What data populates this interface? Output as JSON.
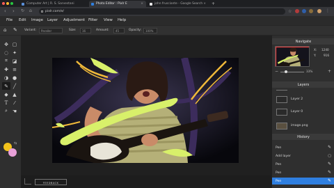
{
  "browser": {
    "tabs": [
      {
        "label": "Computer Art | R. S. Sarvestani"
      },
      {
        "label": "Photo Editor : Pixlr E",
        "active": true
      },
      {
        "label": "john frusciante - Google Search"
      }
    ],
    "url": "pixlr.com/e/",
    "window_dots": [
      "#ff5f57",
      "#febc2e",
      "#28c840"
    ]
  },
  "menubar": {
    "items": [
      "File",
      "Edit",
      "Image",
      "Layer",
      "Adjustment",
      "Filter",
      "View",
      "Help"
    ]
  },
  "options": {
    "variant_label": "Variant:",
    "variant_value": "Paraller",
    "size_label": "Size:",
    "size_value": "16",
    "amount_label": "Amount:",
    "amount_value": "45",
    "opacity_label": "Opacity:",
    "opacity_value": "100%"
  },
  "colors": {
    "primary": "#f2c21b",
    "secondary": "#e8a0d8",
    "accent": "#2f7fe0",
    "stroke": "#d8f06a"
  },
  "tools": [
    "move-icon",
    "marquee-icon",
    "lasso-icon",
    "wand-icon",
    "crop-icon",
    "slice-icon",
    "heal-icon",
    "stamp-icon",
    "dodge-icon",
    "smudge-icon",
    "pen-icon",
    "brush-icon",
    "eraser-icon",
    "bucket-icon",
    "type-icon",
    "eyedropper-icon",
    "zoom-icon",
    "hand-icon"
  ],
  "navigator": {
    "title": "Navigate",
    "x_label": "X:",
    "x_value": "1240",
    "y_label": "Y:",
    "y_value": "916",
    "zoom": "33%"
  },
  "layers": {
    "title": "Layers",
    "items": [
      {
        "name": "Layer 2"
      },
      {
        "name": "Layer 0"
      },
      {
        "name": "image.png"
      }
    ]
  },
  "history": {
    "title": "History",
    "items": [
      {
        "name": "Pen"
      },
      {
        "name": "Add layer"
      },
      {
        "name": "Pen"
      },
      {
        "name": "Pen"
      },
      {
        "name": "Pen"
      }
    ]
  },
  "bottombar": {
    "feedback": "FEEDBACK"
  }
}
